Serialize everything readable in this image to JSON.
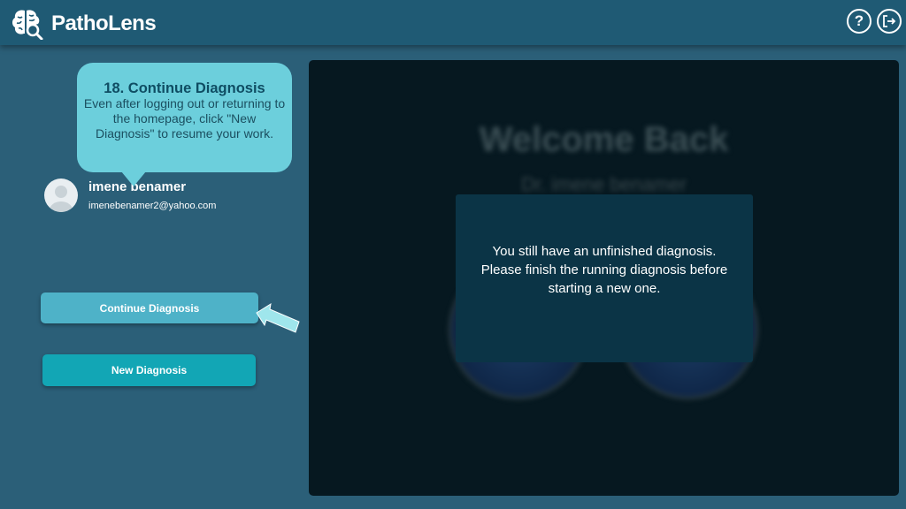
{
  "header": {
    "app_title": "PathoLens",
    "logo_icon": "brain-search-icon",
    "help_label": "?",
    "help_icon": "question-circle-icon",
    "logout_icon": "logout-icon"
  },
  "tooltip": {
    "title": "18. Continue Diagnosis",
    "body": "Even after logging out or returning to the homepage, click \"New Diagnosis\" to resume your work."
  },
  "user": {
    "name": "imene benamer",
    "email": "imenebenamer2@yahoo.com"
  },
  "buttons": {
    "continue_label": "Continue Diagnosis",
    "new_label": "New Diagnosis"
  },
  "background_screen": {
    "title": "Welcome Back",
    "subtitle": "Dr. imene benamer"
  },
  "modal": {
    "line1": "You still have an unfinished diagnosis.",
    "line2": "Please finish the running diagnosis before",
    "line3": "starting a new one."
  },
  "colors": {
    "background": "#2b5f78",
    "header": "#1f5a74",
    "tooltip": "#6ccfdc",
    "continue_button": "#4eb2c8",
    "new_button": "#12a6b5",
    "main_panel": "#061820",
    "modal": "#0b3446"
  }
}
